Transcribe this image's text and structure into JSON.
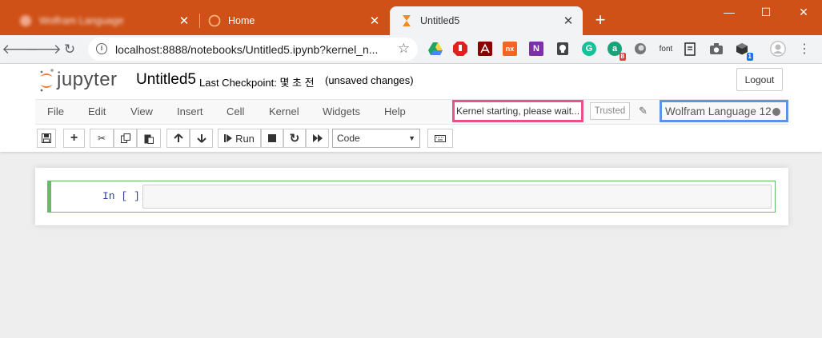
{
  "browser": {
    "tabs": [
      {
        "title": "Wolfram Language",
        "active": false,
        "blurred": true
      },
      {
        "title": "Home",
        "active": false,
        "blurred": false
      },
      {
        "title": "Untitled5",
        "active": true,
        "blurred": false
      }
    ],
    "new_tab_symbol": "+",
    "window_controls": {
      "minimize": "—",
      "maximize": "☐",
      "close": "✕"
    },
    "url": "localhost:8888/notebooks/Untitled5.ipynb?kernel_n...",
    "extensions": [
      {
        "name": "google-drive-icon",
        "color": "#fbbc04"
      },
      {
        "name": "adblock-icon",
        "color": "#e32020"
      },
      {
        "name": "acrobat-icon",
        "color": "#8b0000"
      },
      {
        "name": "screencast-icon",
        "color": "#f26522",
        "label": "nx"
      },
      {
        "name": "onenote-icon",
        "color": "#7b2fa8",
        "label": "N"
      },
      {
        "name": "bulb-icon",
        "color": "#444444"
      },
      {
        "name": "grammarly-icon",
        "color": "#15c39a",
        "label": "G"
      },
      {
        "name": "avatar-ext-icon",
        "color": "#1aa37a",
        "label": "a",
        "badge": "8"
      },
      {
        "name": "circle-ext-icon",
        "color": "#777777"
      },
      {
        "name": "font-ext-icon",
        "color": "#333333",
        "label": "font"
      },
      {
        "name": "clipboard-icon",
        "color": "#333333"
      },
      {
        "name": "camera-icon",
        "color": "#666666"
      },
      {
        "name": "cube-icon",
        "color": "#333333",
        "badge": "1"
      }
    ],
    "theme_color": "#cf5118"
  },
  "jupyter": {
    "logo_text": "jupyter",
    "notebook_name": "Untitled5",
    "checkpoint": "Last Checkpoint: 몇 초 전",
    "autosave_status": "(unsaved changes)",
    "logout_label": "Logout",
    "menu": [
      "File",
      "Edit",
      "View",
      "Insert",
      "Cell",
      "Kernel",
      "Widgets",
      "Help"
    ],
    "kernel_message": "Kernel starting, please wait...",
    "trusted_label": "Trusted",
    "kernel_name": "Wolfram Language 12",
    "toolbar": {
      "save": "💾",
      "insert": "+",
      "cut": "✂",
      "copy": "⎘",
      "paste": "📋",
      "move_up": "🡑",
      "move_down": "🡓",
      "run_label": "Run",
      "stop": "■",
      "restart": "↻",
      "run_all": "⏩",
      "cell_type": "Code",
      "keyboard": "⌨"
    },
    "cell": {
      "prompt": "In [ ]:",
      "content": ""
    },
    "highlight_colors": {
      "kernel_message": "#e8528a",
      "kernel_name": "#5b94e4"
    }
  }
}
